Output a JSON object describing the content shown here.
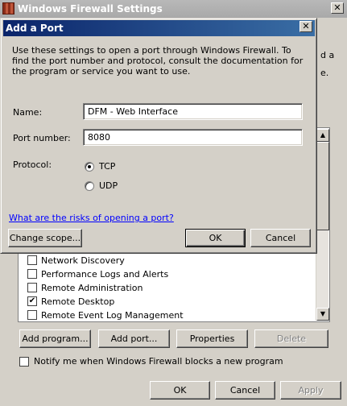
{
  "background_window": {
    "title": "Windows Firewall Settings",
    "right_edge_text": "d a",
    "right_edge_text2": "e.",
    "exceptions": [
      {
        "label": "Network Discovery",
        "checked": false
      },
      {
        "label": "Performance Logs and Alerts",
        "checked": false
      },
      {
        "label": "Remote Administration",
        "checked": false
      },
      {
        "label": "Remote Desktop",
        "checked": true
      },
      {
        "label": "Remote Event Log Management",
        "checked": false
      }
    ],
    "buttons": {
      "add_program": "Add program...",
      "add_port": "Add port...",
      "properties": "Properties",
      "delete": "Delete"
    },
    "notify_label": "Notify me when Windows Firewall blocks a new program",
    "bottom_buttons": {
      "ok": "OK",
      "cancel": "Cancel",
      "apply": "Apply"
    }
  },
  "dialog": {
    "title": "Add a Port",
    "description": "Use these settings to open a port through Windows Firewall. To find the port number and protocol, consult the documentation for the program or service you want to use.",
    "name_label": "Name:",
    "name_value": "DFM - Web Interface",
    "port_label": "Port number:",
    "port_value": "8080",
    "protocol_label": "Protocol:",
    "protocols": [
      {
        "label": "TCP",
        "selected": true
      },
      {
        "label": "UDP",
        "selected": false
      }
    ],
    "risk_link": "What are the risks of opening a port?",
    "change_scope": "Change scope...",
    "ok": "OK",
    "cancel": "Cancel"
  }
}
